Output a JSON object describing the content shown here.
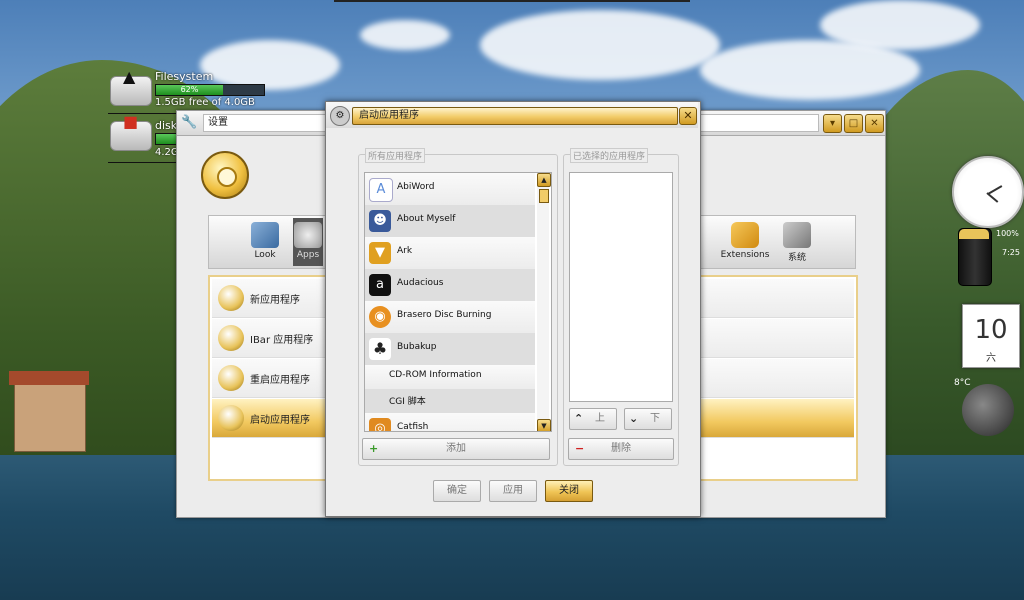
{
  "desktop": {
    "filesystem": {
      "name": "Filesystem",
      "percent": "62%",
      "free": "1.5GB free of 4.0GB"
    },
    "disk2": {
      "name": "disk",
      "free": "4.2G"
    }
  },
  "settings": {
    "title": "设置",
    "toolbar": [
      {
        "label": "Look"
      },
      {
        "label": "Apps"
      },
      {
        "label": "Extensions"
      },
      {
        "label": "系统"
      }
    ],
    "rows": [
      {
        "label": "新应用程序"
      },
      {
        "label": "IBar 应用程序"
      },
      {
        "label": "重启应用程序"
      },
      {
        "label": "启动应用程序"
      }
    ]
  },
  "dialog": {
    "title": "启动应用程序",
    "all_apps_label": "所有应用程序",
    "selected_apps_label": "已选择的应用程序",
    "apps": [
      {
        "label": "AbiWord",
        "icon": "abiword-icon",
        "color": "#5a8bd8"
      },
      {
        "label": "About Myself",
        "icon": "person-icon",
        "color": "#3a5a9a"
      },
      {
        "label": "Ark",
        "icon": "ark-icon",
        "color": "#e0a020"
      },
      {
        "label": "Audacious",
        "icon": "audacious-icon",
        "color": "#111111"
      },
      {
        "label": "Brasero Disc Burning",
        "icon": "brasero-icon",
        "color": "#e89020"
      },
      {
        "label": "Bubakup",
        "icon": "gnome-foot-icon",
        "color": "#222222"
      },
      {
        "label": "CD-ROM Information",
        "icon": "",
        "color": ""
      },
      {
        "label": "CGI 脚本",
        "icon": "",
        "color": ""
      },
      {
        "label": "Catfish",
        "icon": "catfish-icon",
        "color": "#e08a20"
      }
    ],
    "add_label": "添加",
    "up_label": "上",
    "down_label": "下",
    "delete_label": "删除",
    "ok_label": "确定",
    "apply_label": "应用",
    "close_label": "关闭"
  },
  "widgets": {
    "battery_pct": "100%",
    "battery_time": "7:25",
    "calendar_day": "10",
    "calendar_weekday": "六",
    "temperature": "8°C"
  }
}
